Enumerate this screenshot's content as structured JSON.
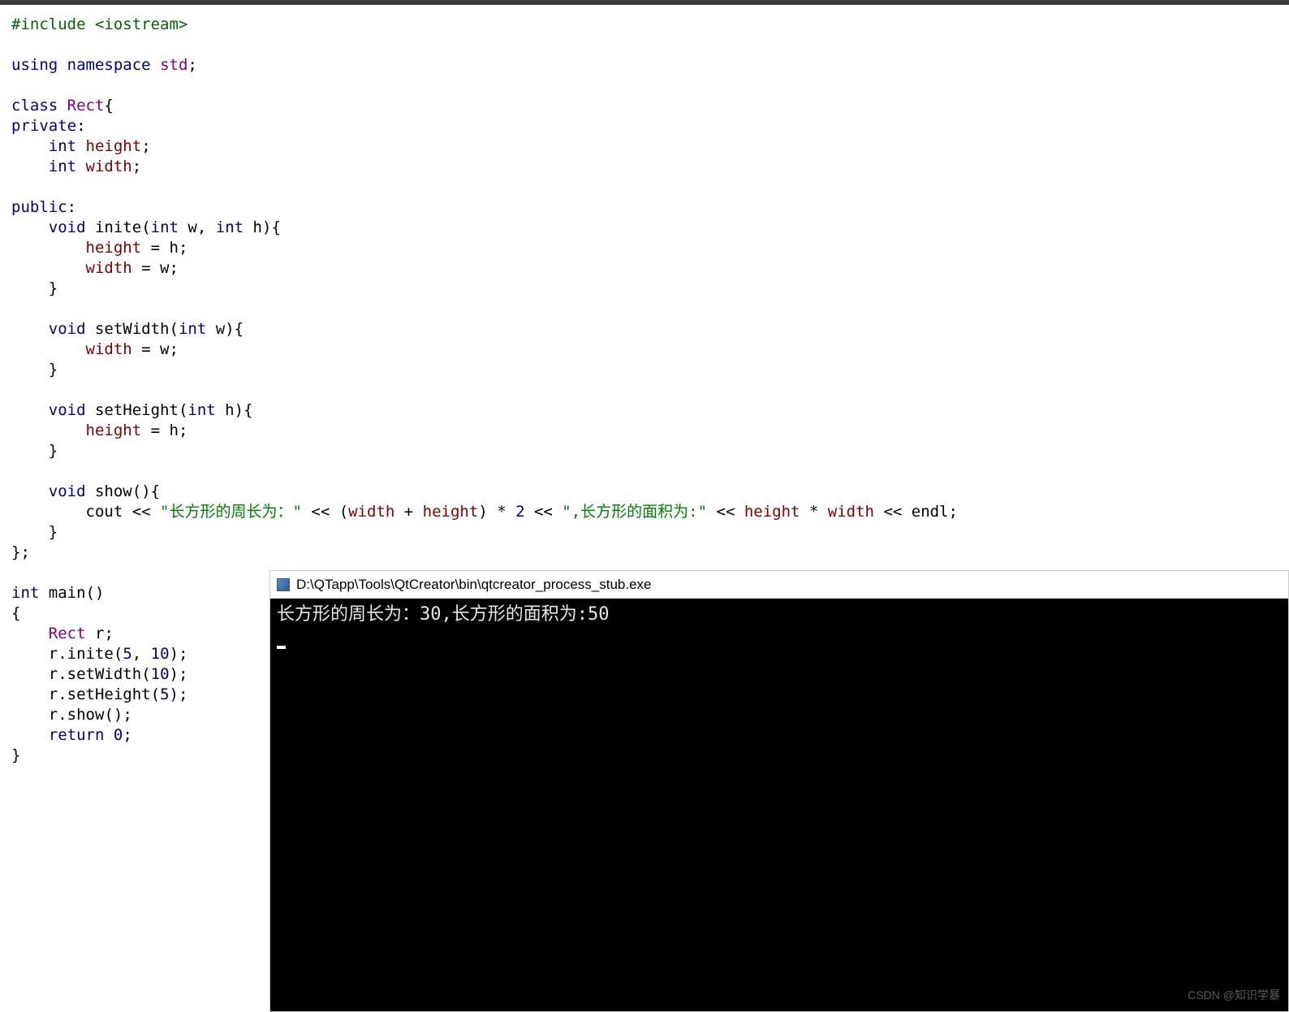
{
  "code": {
    "include_kw": "#include",
    "include_hdr": "<iostream>",
    "using": "using",
    "namespace": "namespace",
    "std": "std",
    "class": "class",
    "Rect": "Rect",
    "private": "private",
    "public": "public",
    "int": "int",
    "void": "void",
    "height": "height",
    "width": "width",
    "inite": "inite",
    "w": "w",
    "h": "h",
    "setWidth": "setWidth",
    "setHeight": "setHeight",
    "show": "show",
    "cout": "cout",
    "str_perimeter": "\"长方形的周长为：\"",
    "mult2": "2",
    "str_area": "\",长方形的面积为:\"",
    "endl": "endl",
    "main": "main",
    "r": "r",
    "five": "5",
    "ten": "10",
    "return": "return",
    "zero": "0"
  },
  "console": {
    "title": "D:\\QTapp\\Tools\\QtCreator\\bin\\qtcreator_process_stub.exe",
    "output": "长方形的周长为：30,长方形的面积为:50"
  },
  "watermark": "CSDN @知识学暴"
}
